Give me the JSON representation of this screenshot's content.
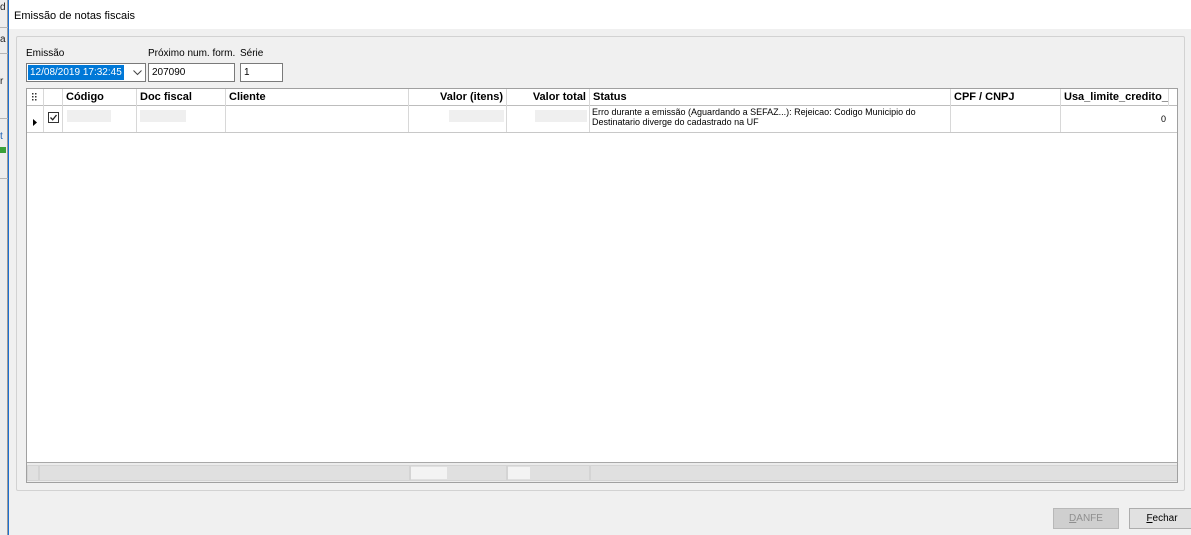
{
  "background_app": {
    "fragments": [
      "d",
      "a",
      "r",
      "t"
    ]
  },
  "window": {
    "title": "Emissão de notas fiscais"
  },
  "form": {
    "emissao_label": "Emissão",
    "emissao_value": "12/08/2019 17:32:45",
    "proximo_label": "Próximo num. form.",
    "proximo_value": "207090",
    "serie_label": "Série",
    "serie_value": "1"
  },
  "grid": {
    "columns": {
      "codigo": "Código",
      "doc_fiscal": "Doc fiscal",
      "cliente": "Cliente",
      "valor_itens": "Valor (itens)",
      "valor_total": "Valor total",
      "status": "Status",
      "cpf_cnpj": "CPF / CNPJ",
      "usa_limite": "Usa_limite_credito_"
    },
    "rows": [
      {
        "checked": true,
        "codigo": "",
        "doc_fiscal": "",
        "cliente": "",
        "valor_itens": "",
        "valor_total": "",
        "status": "Erro durante a emissão (Aguardando a SEFAZ...): Rejeicao: Codigo Municipio do Destinatario diverge do cadastrado na UF",
        "cpf_cnpj": "",
        "usa_limite": "0"
      }
    ]
  },
  "buttons": {
    "danfe_accel": "D",
    "danfe_rest": "ANFE",
    "fechar_accel": "F",
    "fechar_rest": "echar"
  },
  "colors": {
    "selection": "#0078d7",
    "window_border": "#1c6fd1"
  }
}
